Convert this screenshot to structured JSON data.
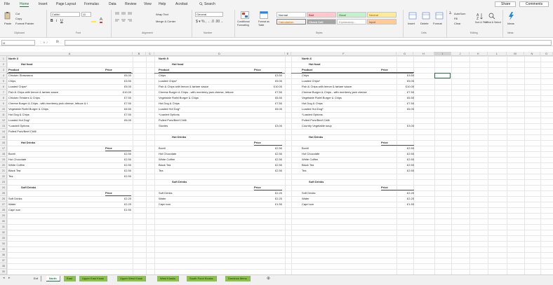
{
  "menu": {
    "tabs": [
      "File",
      "Home",
      "Insert",
      "Page Layout",
      "Formulas",
      "Data",
      "Review",
      "View",
      "Help",
      "Acrobat"
    ],
    "search": "Search",
    "share": "Share",
    "comments": "Comments"
  },
  "ribbon": {
    "clipboard": {
      "cut": "Cut",
      "copy": "Copy",
      "paste": "Paste",
      "format_painter": "Format Painter",
      "label": "Clipboard"
    },
    "font": {
      "name": "Calibri",
      "size": "11",
      "label": "Font"
    },
    "alignment": {
      "wrap": "Wrap Text",
      "merge": "Merge & Center",
      "label": "Alignment"
    },
    "number": {
      "format": "General",
      "label": "Number"
    },
    "styles": {
      "conditional": "Conditional Formatting",
      "table": "Format as Table",
      "label": "Styles",
      "cells": [
        "Normal",
        "Bad",
        "Good",
        "Neutral",
        "Calculation",
        "Check Cell",
        "Explanatory...",
        "Input"
      ]
    },
    "cells": {
      "insert": "Insert",
      "delete": "Delete",
      "format": "Format",
      "label": "Cells"
    },
    "editing": {
      "autosum": "AutoSum",
      "fill": "Fill",
      "clear": "Clear",
      "sort": "Sort & Filter",
      "find": "Find & Select",
      "label": "Editing"
    },
    "ideas": {
      "label": "Ideas"
    }
  },
  "formula_bar": {
    "name_box": "I4",
    "fx": "fx",
    "content": ""
  },
  "columns": [
    "A",
    "B",
    "C",
    "D",
    "E",
    "F",
    "G",
    "H",
    "I",
    "J",
    "K",
    "L",
    "M",
    "N",
    "O"
  ],
  "rows": [
    "1",
    "2",
    "3",
    "4",
    "5",
    "6",
    "7",
    "8",
    "9",
    "10",
    "11",
    "12",
    "13",
    "14",
    "15",
    "16",
    "17",
    "18",
    "19",
    "20",
    "21",
    "22",
    "23",
    "24",
    "25",
    "26",
    "27",
    "28",
    "29",
    "30",
    "31",
    "32",
    "33",
    "34",
    "35",
    "36",
    "37",
    "38",
    "39"
  ],
  "north3": {
    "title": "North 3",
    "hot_food": "Hot food",
    "product": "Product",
    "price": "Price",
    "items": [
      [
        "Chicken Shawarma",
        "£6.00"
      ],
      [
        "Chips",
        "£3.50"
      ],
      [
        "Loaded Chips*",
        "£5.00"
      ],
      [
        "Fish & Chips with lemon & tartare sauce",
        "£10.00"
      ],
      [
        "Chicken Tenders & Chips",
        "£7.50"
      ],
      [
        "Cheese Burger & Chips - with monterey jack cheese, lettuce & t",
        "£7.50"
      ],
      [
        "Vegetable Flafel Burger & Chips",
        "£6.50"
      ],
      [
        "Hot Dog & Chips",
        "£7.50"
      ],
      [
        "Loaded Hot Dog*",
        "£6.00"
      ],
      [
        "*Loaded Options",
        ""
      ],
      [
        "Pulled Pork/Beef Chilli",
        ""
      ]
    ],
    "hot_drinks": "Hot Drinks",
    "drinks": [
      [
        "Bovril",
        "£2.50"
      ],
      [
        "Hot Chocolate",
        "£2.50"
      ],
      [
        "White Coffee",
        "£2.50"
      ],
      [
        "Black Tea",
        "£2.50"
      ],
      [
        "Tea",
        "£2.50"
      ]
    ],
    "soft_drinks": "Soft Drinks",
    "soft": [
      [
        "Soft Drinks",
        "£2.20"
      ],
      [
        "Water",
        "£2.20"
      ],
      [
        "Capri sun",
        "£1.50"
      ]
    ]
  },
  "north5": {
    "title": "North 5",
    "hot_food": "Hot food",
    "product": "Product",
    "price": "Price",
    "items": [
      [
        "Chips",
        "£3.50"
      ],
      [
        "Loaded Chips*",
        "£5.00"
      ],
      [
        "Fish & Chips with lemon & tartare sauce",
        "£10.00"
      ],
      [
        "Cheese Burger & Chips - with monterey jack cheese, lettuce",
        "£7.50"
      ],
      [
        "Vegetable Flafel Burger & Chips",
        "£6.50"
      ],
      [
        "Hot Dog & Chips",
        "£7.50"
      ],
      [
        "Loaded Hot Dog*",
        "£6.00"
      ],
      [
        "*Loaded Options",
        ""
      ],
      [
        "Pulled Pork/Beef Chilli",
        ""
      ],
      [
        "Stovies",
        "£3.00"
      ]
    ],
    "hot_drinks": "Hot Drinks",
    "drinks": [
      [
        "Bovril",
        "£2.50"
      ],
      [
        "Hot Chocolate",
        "£2.50"
      ],
      [
        "White Coffee",
        "£2.50"
      ],
      [
        "Black Tea",
        "£2.50"
      ],
      [
        "Tea",
        "£2.50"
      ]
    ],
    "soft_drinks": "Soft Drinks",
    "soft": [
      [
        "Soft Drinks",
        "£2.20"
      ],
      [
        "Water",
        "£2.20"
      ],
      [
        "Capri sun",
        "£1.50"
      ]
    ]
  },
  "north6": {
    "title": "North 6",
    "hot_food": "Hot food",
    "product": "Product",
    "price": "Price",
    "items": [
      [
        "Chips",
        "£3.50"
      ],
      [
        "Loaded Chips*",
        "£5.00"
      ],
      [
        "Fish & Chips with lemon & tartare sauce",
        "£10.00"
      ],
      [
        "Cheese Burger & Chips - with monterey jack cheese",
        "£7.50"
      ],
      [
        "Vegetable Flafel Burger & Chips",
        "£6.50"
      ],
      [
        "Hot Dog & Chips",
        "£7.50"
      ],
      [
        "Loaded Hot Dog*",
        "£6.00"
      ],
      [
        "*Loaded Options",
        ""
      ],
      [
        "Pulled Pork/Beef Chilli",
        ""
      ],
      [
        "Country Vegetable soup",
        "£3.00"
      ]
    ],
    "hot_drinks": "Hot Drinks",
    "drinks": [
      [
        "Bovril",
        "£2.50"
      ],
      [
        "Hot Chocolate",
        "£2.50"
      ],
      [
        "White Coffee",
        "£2.50"
      ],
      [
        "Black Tea",
        "£2.50"
      ],
      [
        "Tea",
        "£2.50"
      ]
    ],
    "soft_drinks": "Soft Drinks",
    "soft": [
      [
        "Soft Drinks",
        "£2.20"
      ],
      [
        "Water",
        "£2.20"
      ],
      [
        "Capri sun",
        "£1.50"
      ]
    ]
  },
  "sheets": [
    "Enf",
    "North",
    "East",
    "Upper East Kiosk",
    "Upper West Kiosk",
    "West Kiosks",
    "South Food Kiosks",
    "Dominos Menu"
  ],
  "colors": {
    "accent": "#217346",
    "tab_green": "#8bc34a",
    "bad": "#ffc7ce",
    "good": "#c6efce",
    "neutral": "#ffeb9c",
    "calc": "#f2f2f2",
    "check": "#a5a5a5",
    "input": "#ffcc99"
  }
}
